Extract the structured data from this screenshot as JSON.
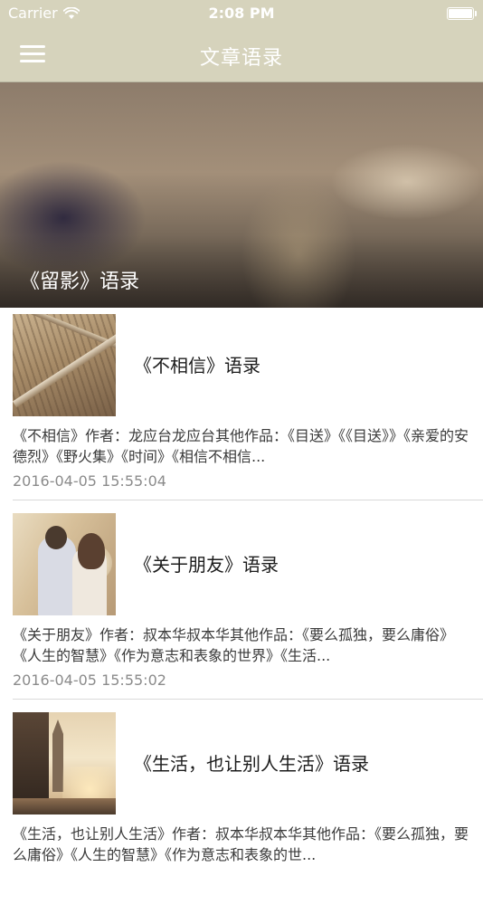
{
  "status_bar": {
    "carrier": "Carrier",
    "time": "2:08 PM"
  },
  "nav": {
    "title": "文章语录",
    "menu_icon": "hamburger-menu-icon"
  },
  "banner": {
    "title": "《留影》语录"
  },
  "articles": [
    {
      "title": "《不相信》语录",
      "summary": "《不相信》作者：龙应台龙应台其他作品：《目送》《《目送》》《亲爱的安德烈》《野火集》《时间》《相信不相信...",
      "date": "2016-04-05 15:55:04"
    },
    {
      "title": "《关于朋友》语录",
      "summary": "《关于朋友》作者：叔本华叔本华其他作品：《要么孤独，要么庸俗》《人生的智慧》《作为意志和表象的世界》《生活...",
      "date": "2016-04-05 15:55:02"
    },
    {
      "title": "《生活，也让别人生活》语录",
      "summary": "《生活，也让别人生活》作者：叔本华叔本华其他作品：《要么孤独，要么庸俗》《人生的智慧》《作为意志和表象的世...",
      "date": ""
    }
  ]
}
